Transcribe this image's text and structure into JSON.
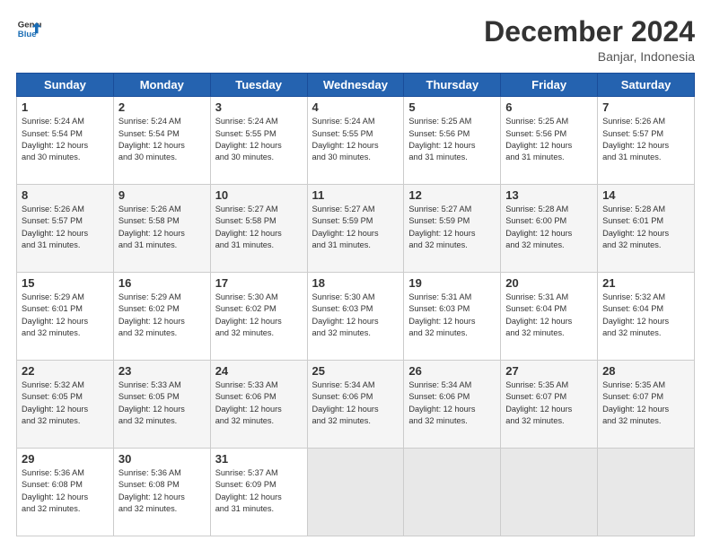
{
  "logo": {
    "line1": "General",
    "line2": "Blue"
  },
  "title": "December 2024",
  "subtitle": "Banjar, Indonesia",
  "days_header": [
    "Sunday",
    "Monday",
    "Tuesday",
    "Wednesday",
    "Thursday",
    "Friday",
    "Saturday"
  ],
  "weeks": [
    [
      {
        "day": "1",
        "info": "Sunrise: 5:24 AM\nSunset: 5:54 PM\nDaylight: 12 hours\nand 30 minutes."
      },
      {
        "day": "2",
        "info": "Sunrise: 5:24 AM\nSunset: 5:54 PM\nDaylight: 12 hours\nand 30 minutes."
      },
      {
        "day": "3",
        "info": "Sunrise: 5:24 AM\nSunset: 5:55 PM\nDaylight: 12 hours\nand 30 minutes."
      },
      {
        "day": "4",
        "info": "Sunrise: 5:24 AM\nSunset: 5:55 PM\nDaylight: 12 hours\nand 30 minutes."
      },
      {
        "day": "5",
        "info": "Sunrise: 5:25 AM\nSunset: 5:56 PM\nDaylight: 12 hours\nand 31 minutes."
      },
      {
        "day": "6",
        "info": "Sunrise: 5:25 AM\nSunset: 5:56 PM\nDaylight: 12 hours\nand 31 minutes."
      },
      {
        "day": "7",
        "info": "Sunrise: 5:26 AM\nSunset: 5:57 PM\nDaylight: 12 hours\nand 31 minutes."
      }
    ],
    [
      {
        "day": "8",
        "info": "Sunrise: 5:26 AM\nSunset: 5:57 PM\nDaylight: 12 hours\nand 31 minutes."
      },
      {
        "day": "9",
        "info": "Sunrise: 5:26 AM\nSunset: 5:58 PM\nDaylight: 12 hours\nand 31 minutes."
      },
      {
        "day": "10",
        "info": "Sunrise: 5:27 AM\nSunset: 5:58 PM\nDaylight: 12 hours\nand 31 minutes."
      },
      {
        "day": "11",
        "info": "Sunrise: 5:27 AM\nSunset: 5:59 PM\nDaylight: 12 hours\nand 31 minutes."
      },
      {
        "day": "12",
        "info": "Sunrise: 5:27 AM\nSunset: 5:59 PM\nDaylight: 12 hours\nand 32 minutes."
      },
      {
        "day": "13",
        "info": "Sunrise: 5:28 AM\nSunset: 6:00 PM\nDaylight: 12 hours\nand 32 minutes."
      },
      {
        "day": "14",
        "info": "Sunrise: 5:28 AM\nSunset: 6:01 PM\nDaylight: 12 hours\nand 32 minutes."
      }
    ],
    [
      {
        "day": "15",
        "info": "Sunrise: 5:29 AM\nSunset: 6:01 PM\nDaylight: 12 hours\nand 32 minutes."
      },
      {
        "day": "16",
        "info": "Sunrise: 5:29 AM\nSunset: 6:02 PM\nDaylight: 12 hours\nand 32 minutes."
      },
      {
        "day": "17",
        "info": "Sunrise: 5:30 AM\nSunset: 6:02 PM\nDaylight: 12 hours\nand 32 minutes."
      },
      {
        "day": "18",
        "info": "Sunrise: 5:30 AM\nSunset: 6:03 PM\nDaylight: 12 hours\nand 32 minutes."
      },
      {
        "day": "19",
        "info": "Sunrise: 5:31 AM\nSunset: 6:03 PM\nDaylight: 12 hours\nand 32 minutes."
      },
      {
        "day": "20",
        "info": "Sunrise: 5:31 AM\nSunset: 6:04 PM\nDaylight: 12 hours\nand 32 minutes."
      },
      {
        "day": "21",
        "info": "Sunrise: 5:32 AM\nSunset: 6:04 PM\nDaylight: 12 hours\nand 32 minutes."
      }
    ],
    [
      {
        "day": "22",
        "info": "Sunrise: 5:32 AM\nSunset: 6:05 PM\nDaylight: 12 hours\nand 32 minutes."
      },
      {
        "day": "23",
        "info": "Sunrise: 5:33 AM\nSunset: 6:05 PM\nDaylight: 12 hours\nand 32 minutes."
      },
      {
        "day": "24",
        "info": "Sunrise: 5:33 AM\nSunset: 6:06 PM\nDaylight: 12 hours\nand 32 minutes."
      },
      {
        "day": "25",
        "info": "Sunrise: 5:34 AM\nSunset: 6:06 PM\nDaylight: 12 hours\nand 32 minutes."
      },
      {
        "day": "26",
        "info": "Sunrise: 5:34 AM\nSunset: 6:06 PM\nDaylight: 12 hours\nand 32 minutes."
      },
      {
        "day": "27",
        "info": "Sunrise: 5:35 AM\nSunset: 6:07 PM\nDaylight: 12 hours\nand 32 minutes."
      },
      {
        "day": "28",
        "info": "Sunrise: 5:35 AM\nSunset: 6:07 PM\nDaylight: 12 hours\nand 32 minutes."
      }
    ],
    [
      {
        "day": "29",
        "info": "Sunrise: 5:36 AM\nSunset: 6:08 PM\nDaylight: 12 hours\nand 32 minutes."
      },
      {
        "day": "30",
        "info": "Sunrise: 5:36 AM\nSunset: 6:08 PM\nDaylight: 12 hours\nand 32 minutes."
      },
      {
        "day": "31",
        "info": "Sunrise: 5:37 AM\nSunset: 6:09 PM\nDaylight: 12 hours\nand 31 minutes."
      },
      {
        "day": "",
        "info": ""
      },
      {
        "day": "",
        "info": ""
      },
      {
        "day": "",
        "info": ""
      },
      {
        "day": "",
        "info": ""
      }
    ]
  ]
}
